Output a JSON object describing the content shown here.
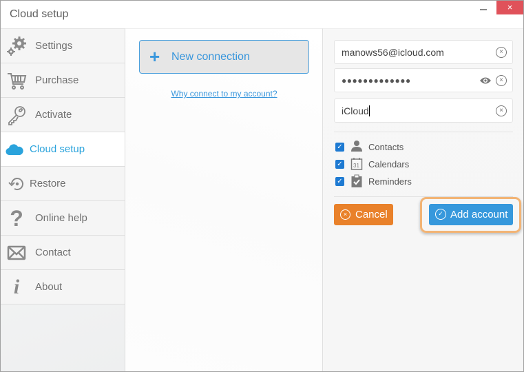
{
  "window": {
    "title": "Cloud setup",
    "minimize_label": "–",
    "close_label": "×"
  },
  "sidebar": {
    "items": [
      {
        "label": "Settings",
        "icon": "gears-icon"
      },
      {
        "label": "Purchase",
        "icon": "cart-icon"
      },
      {
        "label": "Activate",
        "icon": "key-icon"
      },
      {
        "label": "Cloud setup",
        "icon": "cloud-icon",
        "active": true
      },
      {
        "label": "Restore",
        "icon": "restore-icon"
      },
      {
        "label": "Online help",
        "icon": "question-icon"
      },
      {
        "label": "Contact",
        "icon": "envelope-icon"
      },
      {
        "label": "About",
        "icon": "info-icon"
      }
    ]
  },
  "middle": {
    "new_connection_label": "New connection",
    "plus_glyph": "+",
    "why_link": "Why connect to my account?"
  },
  "form": {
    "email": "manows56@icloud.com",
    "password_masked": "●●●●●●●●●●●●●",
    "account_name": "iCloud",
    "clear_glyph": "×",
    "options": [
      {
        "label": "Contacts",
        "checked": true,
        "icon": "person-icon"
      },
      {
        "label": "Calendars",
        "checked": true,
        "icon": "calendar-icon"
      },
      {
        "label": "Reminders",
        "checked": true,
        "icon": "clipboard-check-icon"
      }
    ],
    "check_glyph": "✓",
    "cancel_label": "Cancel",
    "add_label": "Add account"
  },
  "colors": {
    "accent_blue": "#3698dc",
    "active_nav": "#2aa3dc",
    "cancel_orange": "#e9812a",
    "focus_ring": "#f2b475",
    "close_red": "#e0525a"
  }
}
